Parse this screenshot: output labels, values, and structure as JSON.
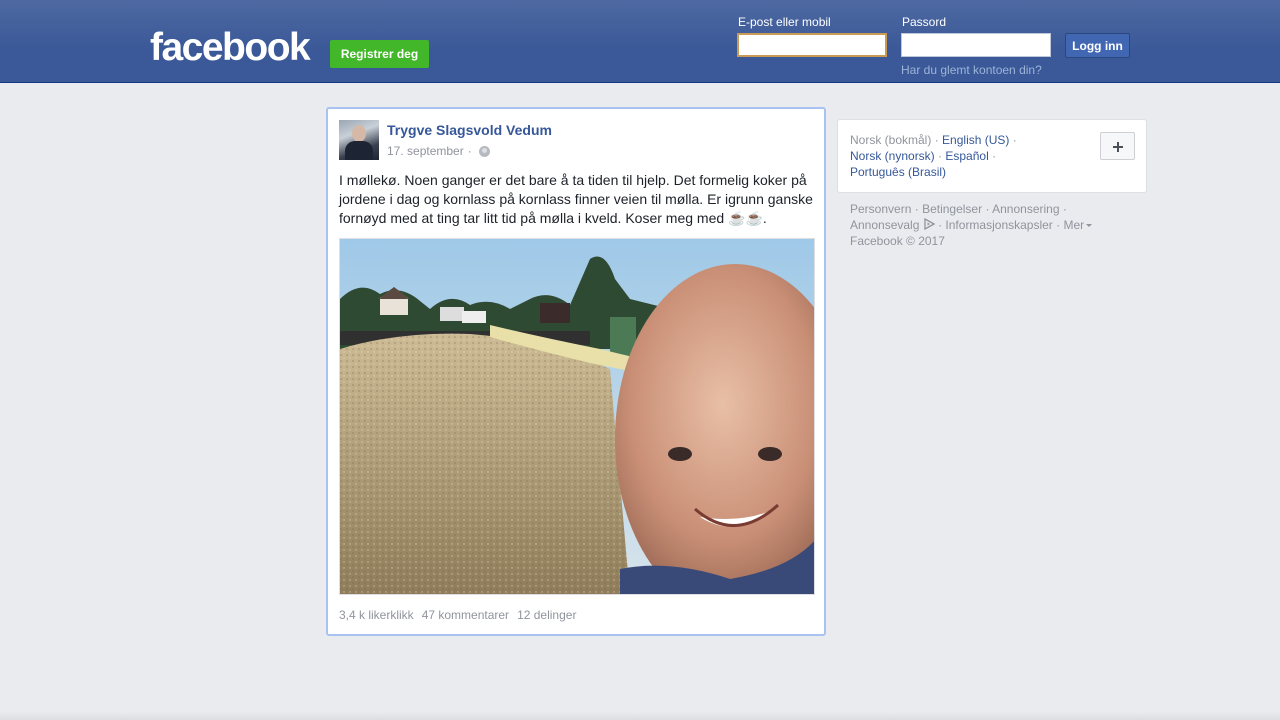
{
  "header": {
    "logo_text": "facebook",
    "register_label": "Registrer deg",
    "email_label": "E-post eller mobil",
    "password_label": "Passord",
    "login_label": "Logg inn",
    "forgot_label": "Har du glemt kontoen din?",
    "brand_color": "#3b5998"
  },
  "post": {
    "author": "Trygve Slagsvold Vedum",
    "date": "17. september",
    "date_separator": "·",
    "audience_icon": "globe-icon",
    "text": "I møllekø. Noen ganger er det bare å ta tiden til hjelp. Det formelig koker på jordene i dag og kornlass på kornlass finner veien til mølla. Er igrunn ganske fornøyd med at ting tar litt tid på mølla i kveld. Koser meg med ☕☕.",
    "likes": "3,4 k likerklikk",
    "comments": "47 kommentarer",
    "shares": "12 delinger"
  },
  "languages": {
    "current": "Norsk (bokmål)",
    "options": [
      "English (US)",
      "Norsk (nynorsk)",
      "Español",
      "Português (Brasil)"
    ],
    "separator": "·"
  },
  "footer": {
    "links": [
      "Personvern",
      "Betingelser",
      "Annonsering",
      "Annonsevalg",
      "Informasjonskapsler",
      "Mer"
    ],
    "separator": "·",
    "copyright": "Facebook © 2017"
  }
}
